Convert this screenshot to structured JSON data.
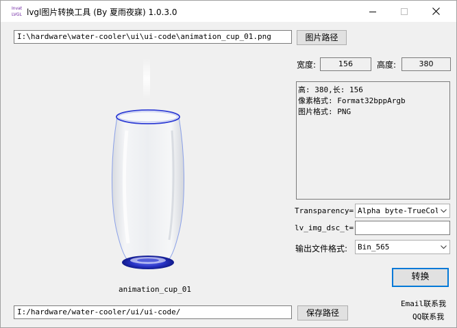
{
  "window": {
    "title": "lvgl图片转换工具 (By 夏雨夜寐) 1.0.3.0",
    "icon_text_top": "Invat",
    "icon_text_bottom": "LVGL"
  },
  "image_path": {
    "value": "I:\\hardware\\water-cooler\\ui\\ui-code\\animation_cup_01.png",
    "button_label": "图片路径"
  },
  "dimensions": {
    "width_label": "宽度:",
    "width_value": "156",
    "height_label": "高度:",
    "height_value": "380"
  },
  "info": {
    "lines": [
      "高: 380,长: 156",
      "像素格式: Format32bppArgb",
      "图片格式: PNG"
    ]
  },
  "preview": {
    "caption": "animation_cup_01",
    "icon": "glass-cup-image"
  },
  "transparency": {
    "label": "Transparency=",
    "selected": "Alpha byte-TrueColor"
  },
  "dsc": {
    "label": "lv_img_dsc_t=",
    "value": ""
  },
  "output_format": {
    "label": "输出文件格式:",
    "selected": "Bin_565"
  },
  "convert_button": "转换",
  "save_path": {
    "value": "I:/hardware/water-cooler/ui/ui-code/",
    "button_label": "保存路径"
  },
  "contact": {
    "email": "Email联系我",
    "qq": "QQ联系我"
  },
  "colors": {
    "accent": "#0078d7",
    "cup_rim": "#2c3bd4"
  }
}
